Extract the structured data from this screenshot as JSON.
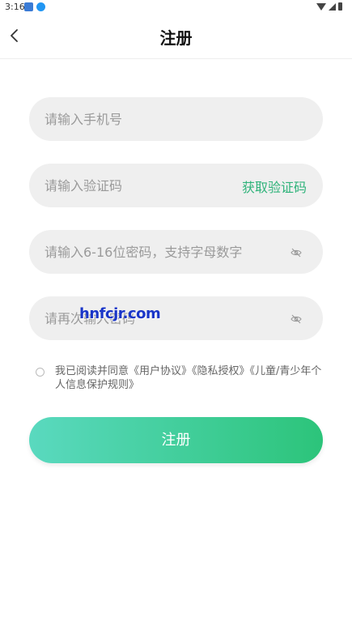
{
  "status_bar": {
    "time": "3:16"
  },
  "header": {
    "title": "注册",
    "back_icon": "chevron-left-icon"
  },
  "form": {
    "phone_placeholder": "请输入手机号",
    "code_placeholder": "请输入验证码",
    "get_code_label": "获取验证码",
    "password_placeholder": "请输入6-16位密码，支持字母数字",
    "confirm_password_placeholder": "请再次输入密码",
    "eye_icon": "eye-hidden-icon"
  },
  "watermark": "hnfcjr.com",
  "agreement": {
    "text": "我已阅读并同意《用户协议》《隐私授权》《儿童/青少年个人信息保护规则》",
    "checked": false
  },
  "submit": {
    "label": "注册"
  },
  "colors": {
    "accent": "#2fb37a",
    "field_bg": "#efefef",
    "button_gradient_start": "#5ad9bf",
    "button_gradient_end": "#2cc47a"
  }
}
